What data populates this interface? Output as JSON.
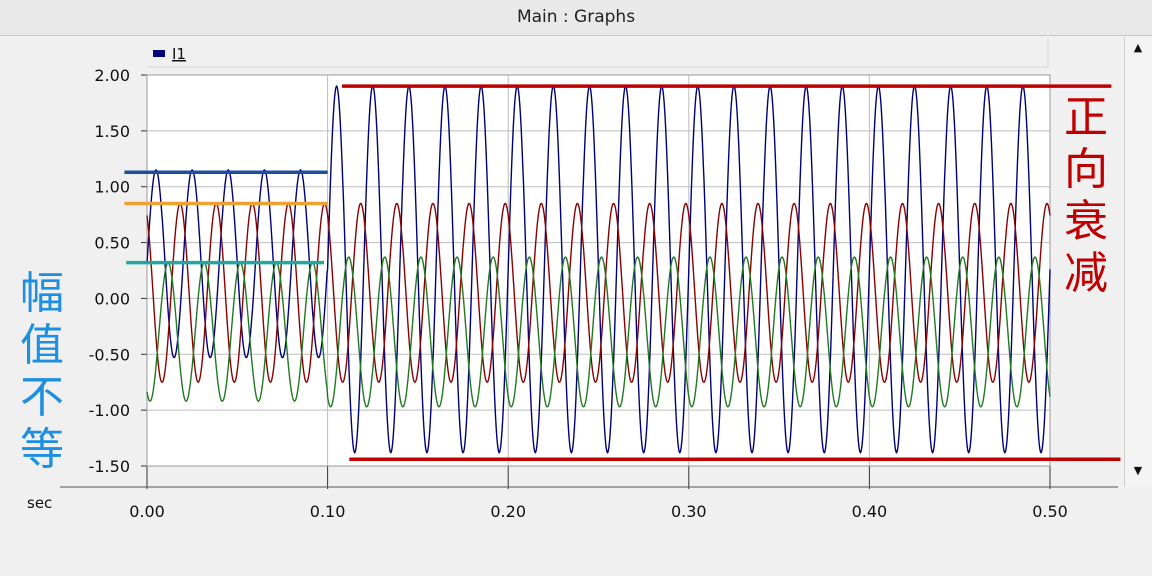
{
  "window": {
    "title": "Main : Graphs"
  },
  "scrollbar": {
    "up_icon": "▲",
    "down_icon": "▼"
  },
  "annotations": {
    "left_text": "幅\n值\n不\n等",
    "right_text": "正\n向\n衰\n减",
    "left_color": "#1e8fe0",
    "right_color": "#c00000"
  },
  "chart_data": {
    "type": "line",
    "legend": [
      {
        "name": "I1",
        "color": "#00007a"
      }
    ],
    "xlabel": "sec",
    "xlim": [
      0.0,
      0.5
    ],
    "ylim": [
      -1.5,
      2.0
    ],
    "x_ticks": [
      "0.00",
      "0.10",
      "0.20",
      "0.30",
      "0.40",
      "0.50"
    ],
    "y_ticks": [
      "2.00",
      "1.50",
      "1.00",
      "0.50",
      "0.00",
      "-0.50",
      "-1.00",
      "-1.50"
    ],
    "grid": true,
    "frequency_hz": 50,
    "step_time": 0.1,
    "series": [
      {
        "color": "#00007a",
        "before": {
          "offset": 0.31,
          "amplitude": 0.84
        },
        "after": {
          "offset": 0.26,
          "amplitude": 1.64
        },
        "phase_deg": 0
      },
      {
        "color": "#8b0000",
        "before": {
          "offset": 0.05,
          "amplitude": 0.8
        },
        "after": {
          "offset": 0.05,
          "amplitude": 0.8
        },
        "phase_deg": 120
      },
      {
        "color": "#1f7a1f",
        "before": {
          "offset": -0.3,
          "amplitude": 0.62
        },
        "after": {
          "offset": -0.3,
          "amplitude": 0.67
        },
        "phase_deg": 240
      }
    ],
    "reference_lines": [
      {
        "y": 1.13,
        "x": [
          -0.0125,
          0.1
        ],
        "color": "#1f4e9c"
      },
      {
        "y": 0.85,
        "x": [
          -0.0125,
          0.1
        ],
        "color": "#f0a030"
      },
      {
        "y": 0.32,
        "x": [
          -0.0115,
          0.098
        ],
        "color": "#20a8a0"
      },
      {
        "y": 1.9,
        "x": [
          0.108,
          0.534
        ],
        "color": "#c00000"
      },
      {
        "y": -1.44,
        "x": [
          0.112,
          0.539
        ],
        "color": "#c00000"
      }
    ]
  }
}
